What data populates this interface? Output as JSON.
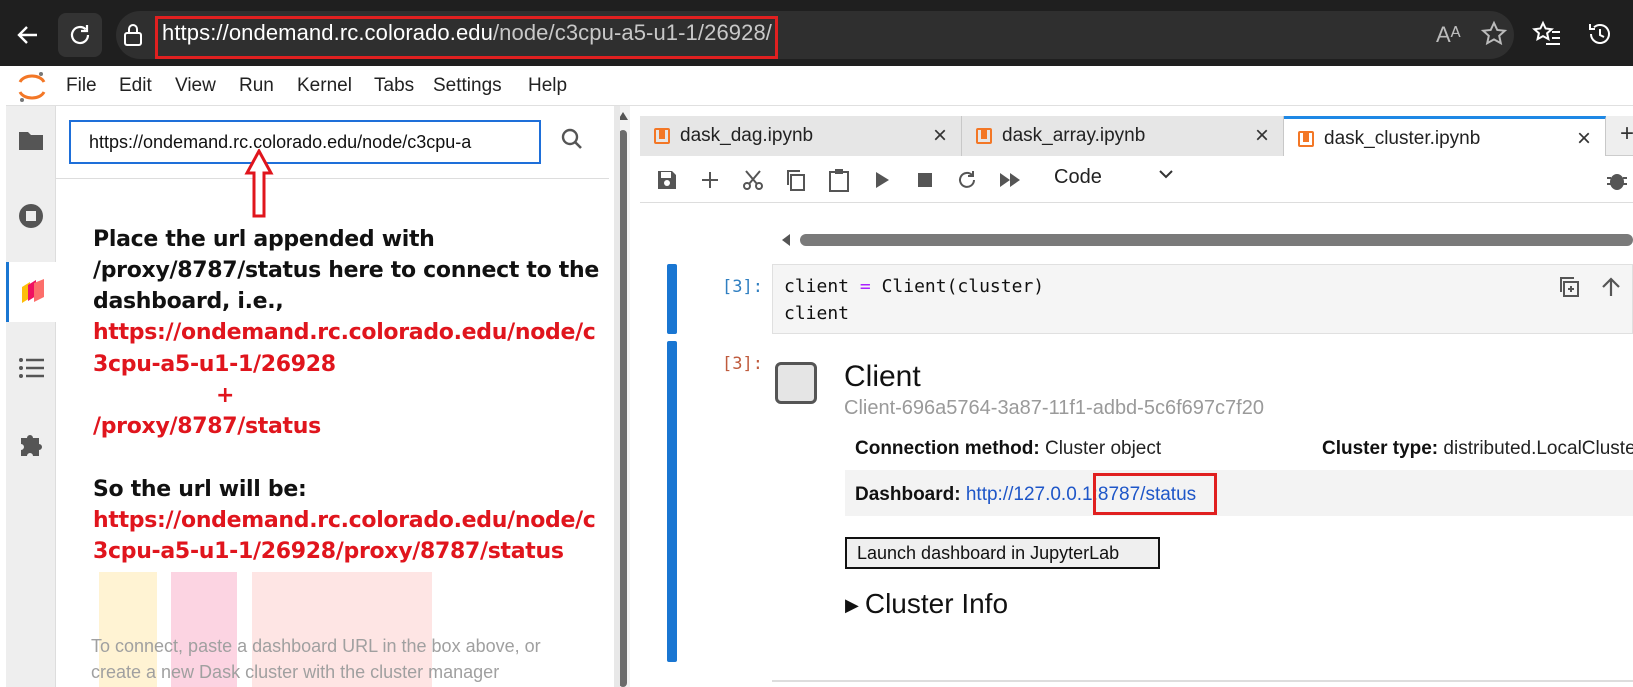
{
  "browser": {
    "url_host": "https://ondemand.rc.colorado.edu",
    "url_path": "/node/c3cpu-a5-u1-1/26928/",
    "read_aloud_label": "Aᴬ"
  },
  "menu": [
    "File",
    "Edit",
    "View",
    "Run",
    "Kernel",
    "Tabs",
    "Settings",
    "Help"
  ],
  "sidebar": {
    "input_value": "https://ondemand.rc.colorado.edu/node/c3cpu-a",
    "annotation_lines": [
      "Place the url appended with",
      "/proxy/8787/status here to connect to the",
      "dashboard, i.e.,"
    ],
    "annotation_red_lines": [
      "https://ondemand.rc.colorado.edu/node/c",
      "3cpu-a5-u1-1/26928",
      "+",
      "/proxy/8787/status"
    ],
    "so_label": "So the url will be:",
    "final_url_lines": [
      "https://ondemand.rc.colorado.edu/node/c",
      "3cpu-a5-u1-1/26928/proxy/8787/status"
    ],
    "help_lines": [
      "To connect, paste a dashboard URL in the box above, or",
      "create a new Dask cluster with the cluster manager"
    ]
  },
  "tabs": [
    {
      "label": "dask_dag.ipynb",
      "active": false
    },
    {
      "label": "dask_array.ipynb",
      "active": false
    },
    {
      "label": "dask_cluster.ipynb",
      "active": true
    }
  ],
  "toolbar": {
    "cell_type": "Code"
  },
  "cell_in": {
    "prompt": "[3]:",
    "code_var": "client",
    "code_op": "=",
    "code_call": "Client(cluster)",
    "code_line2": "client"
  },
  "cell_out": {
    "prompt": "[3]:",
    "title": "Client",
    "client_id": "Client-696a5764-3a87-11f1-adbd-5c6f697c7f20",
    "connection_label": "Connection method:",
    "connection_value": "Cluster object",
    "cluster_type_label": "Cluster type:",
    "cluster_type_value": "distributed.LocalCluste",
    "dashboard_label": "Dashboard:",
    "dashboard_url": "http://127.0.0.1:8787/status",
    "launch_button": "Launch dashboard in JupyterLab",
    "cluster_info": "Cluster Info"
  },
  "colors": {
    "accent": "#1976d2",
    "highlight": "#e02020",
    "annotation_red": "#e0151d",
    "jupyter_orange": "#f37726"
  }
}
